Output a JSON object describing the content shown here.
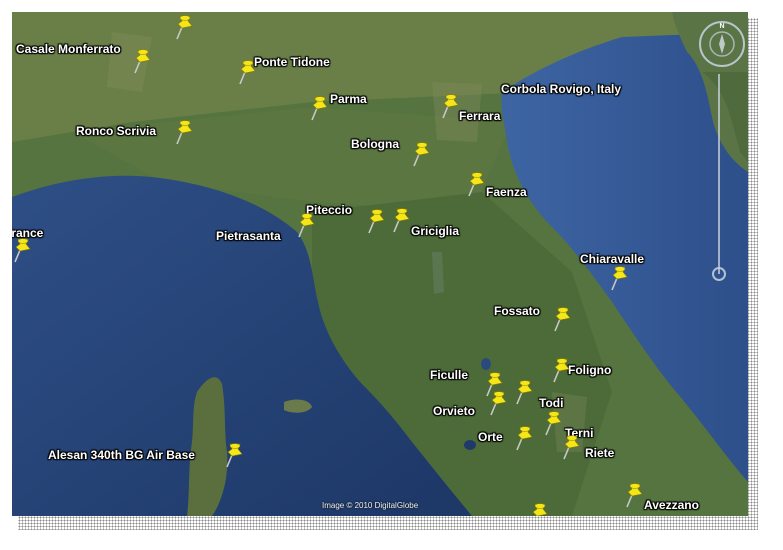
{
  "places": [
    {
      "id": "casale-monferrato",
      "label": "Casale Monferrato"
    },
    {
      "id": "ponte-tidone",
      "label": "Ponte Tidone"
    },
    {
      "id": "parma",
      "label": "Parma"
    },
    {
      "id": "corbola-rovigo",
      "label": "Corbola Rovigo, Italy"
    },
    {
      "id": "ferrara",
      "label": "Ferrara"
    },
    {
      "id": "ronco-scrivia",
      "label": "Ronco Scrivia"
    },
    {
      "id": "bologna",
      "label": "Bologna"
    },
    {
      "id": "faenza",
      "label": "Faenza"
    },
    {
      "id": "france",
      "label": "France"
    },
    {
      "id": "piteccio",
      "label": "Piteccio"
    },
    {
      "id": "pietrasanta",
      "label": "Pietrasanta"
    },
    {
      "id": "griciglia",
      "label": "Griciglia"
    },
    {
      "id": "chiaravalle",
      "label": "Chiaravalle"
    },
    {
      "id": "fossato",
      "label": "Fossato"
    },
    {
      "id": "ficulle",
      "label": "Ficulle"
    },
    {
      "id": "foligno",
      "label": "Foligno"
    },
    {
      "id": "orvieto",
      "label": "Orvieto"
    },
    {
      "id": "todi",
      "label": "Todi"
    },
    {
      "id": "orte",
      "label": "Orte"
    },
    {
      "id": "terni",
      "label": "Terni"
    },
    {
      "id": "alesan",
      "label": "Alesan  340th BG Air Base"
    },
    {
      "id": "riete",
      "label": "Riete"
    },
    {
      "id": "avezzano",
      "label": "Avezzano"
    }
  ],
  "pin_color": "#f5e61a",
  "imagery_credit": "Image © 2010 DigitalGlobe",
  "compass_letter": "N",
  "compass_icon": "compass-icon",
  "zoom_icon": "zoom-slider-icon"
}
